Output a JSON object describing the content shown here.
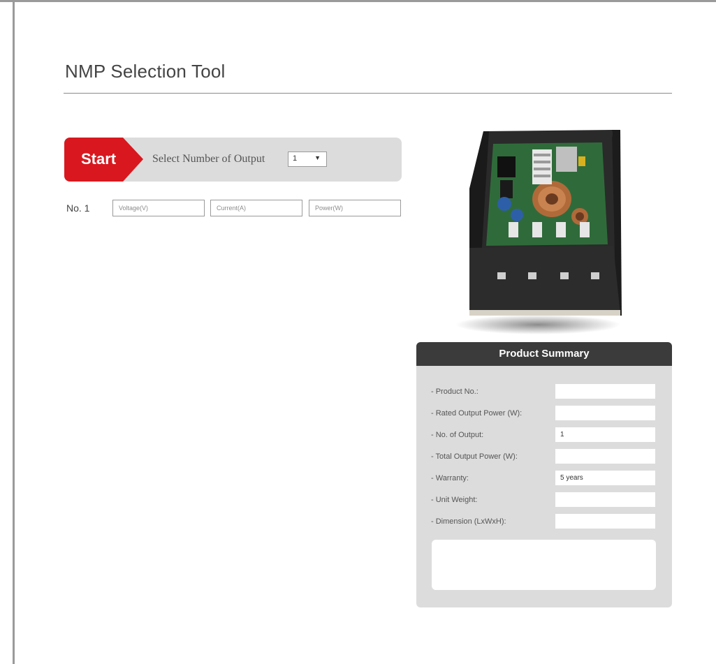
{
  "page": {
    "title": "NMP Selection Tool"
  },
  "start_bar": {
    "start_label": "Start",
    "select_label": "Select Number of Output",
    "output_count": "1"
  },
  "outputs": [
    {
      "label": "No. 1",
      "voltage_placeholder": "Voltage(V)",
      "current_placeholder": "Current(A)",
      "power_placeholder": "Power(W)"
    }
  ],
  "summary": {
    "title": "Product Summary",
    "rows": [
      {
        "label": "- Product No.:",
        "value": ""
      },
      {
        "label": "- Rated Output Power (W):",
        "value": ""
      },
      {
        "label": "- No. of Output:",
        "value": "1"
      },
      {
        "label": "- Total Output Power (W):",
        "value": ""
      },
      {
        "label": "- Warranty:",
        "value": "5 years"
      },
      {
        "label": "- Unit Weight:",
        "value": ""
      },
      {
        "label": "- Dimension (LxWxH):",
        "value": ""
      }
    ]
  },
  "colors": {
    "accent_red": "#d8181e",
    "panel_gray": "#dcdcdc",
    "header_dark": "#3b3b3b"
  },
  "icons": {
    "dropdown": "chevron-down-icon"
  }
}
